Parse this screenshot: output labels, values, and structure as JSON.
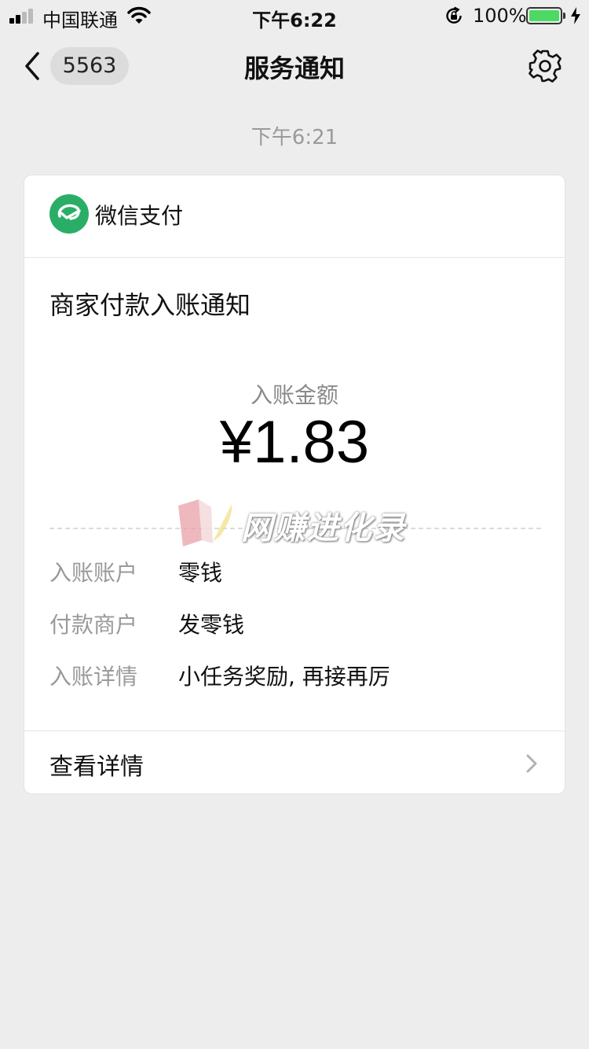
{
  "status": {
    "carrier": "中国联通",
    "time": "下午6:22",
    "battery": "100%",
    "battery_level": 1.0
  },
  "nav": {
    "back_badge": "5563",
    "title": "服务通知"
  },
  "message": {
    "time": "下午6:21"
  },
  "card": {
    "source": "微信支付",
    "title": "商家付款入账通知",
    "amount_label": "入账金额",
    "amount": "¥1.83",
    "rows": [
      {
        "key": "入账账户",
        "value": "零钱"
      },
      {
        "key": "付款商户",
        "value": "发零钱"
      },
      {
        "key": "入账详情",
        "value": "小任务奖励, 再接再厉"
      }
    ],
    "footer": "查看详情"
  },
  "watermark": {
    "text": "网赚进化录"
  },
  "colors": {
    "wechat_green": "#2aae67",
    "battery_green": "#4cd964",
    "background": "#ededed"
  }
}
